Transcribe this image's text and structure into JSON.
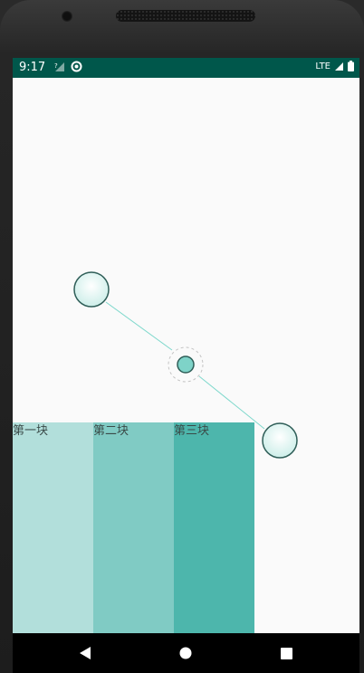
{
  "status_bar": {
    "time": "9:17",
    "network": "LTE",
    "color": "#00574b",
    "icons": [
      "no-sim-signal-icon",
      "data-saver-icon",
      "signal-icon",
      "battery-icon"
    ]
  },
  "canvas": {
    "handle_fill_color": "#e8f8f6",
    "handle_stroke_color": "#2f5e58",
    "line_color": "#7fd8cc",
    "center_dot_color": "#7ed3c8",
    "icons": [
      "drag-handle-start-icon",
      "center-control-icon",
      "drag-handle-end-icon"
    ]
  },
  "blocks": [
    {
      "label": "第一块",
      "color": "#b2dfdb"
    },
    {
      "label": "第二块",
      "color": "#80cbc4"
    },
    {
      "label": "第三块",
      "color": "#4db6ac"
    }
  ],
  "nav_bar": {
    "icons": [
      "back-icon",
      "home-icon",
      "recents-icon"
    ]
  }
}
